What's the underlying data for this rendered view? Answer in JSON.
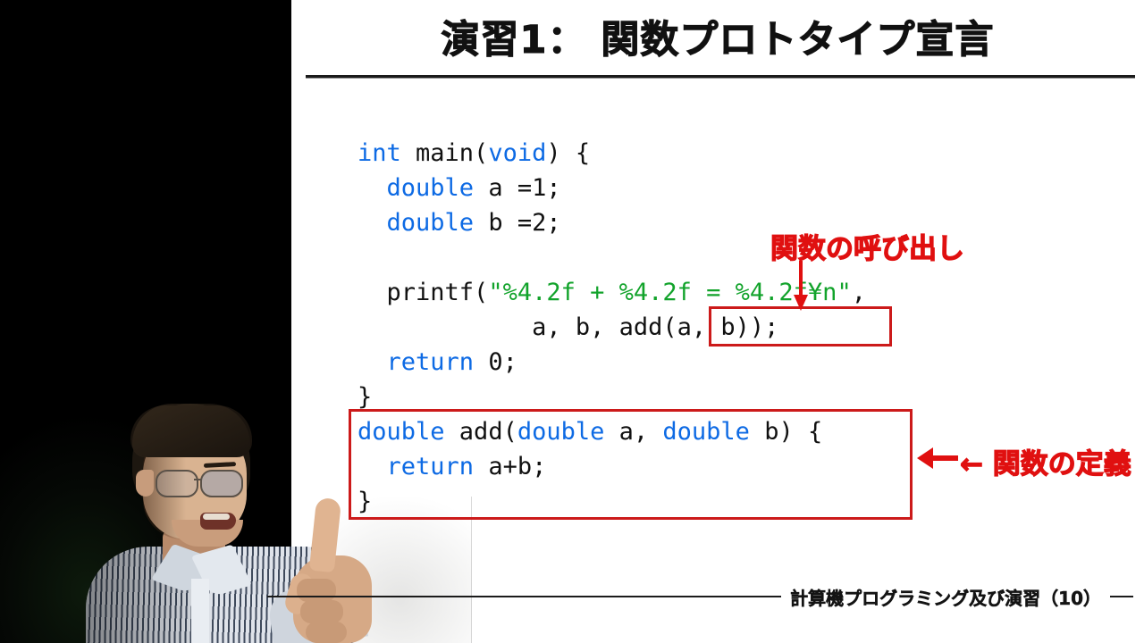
{
  "slide": {
    "title": "演習1： 関数プロトタイプ宣言",
    "footer_text": "計算機プログラミング及び演習（10）"
  },
  "code": {
    "lines": [
      [
        {
          "t": "int",
          "c": "kw"
        },
        {
          "t": " main(",
          "c": "pl"
        },
        {
          "t": "void",
          "c": "kw"
        },
        {
          "t": ") {",
          "c": "pl"
        }
      ],
      [
        {
          "t": "  ",
          "c": "pl"
        },
        {
          "t": "double",
          "c": "kw"
        },
        {
          "t": " a =1;",
          "c": "pl"
        }
      ],
      [
        {
          "t": "  ",
          "c": "pl"
        },
        {
          "t": "double",
          "c": "kw"
        },
        {
          "t": " b =2;",
          "c": "pl"
        }
      ],
      [
        {
          "t": "",
          "c": "pl"
        }
      ],
      [
        {
          "t": "  printf(",
          "c": "pl"
        },
        {
          "t": "\"%4.2f + %4.2f = %4.2f¥n\"",
          "c": "str"
        },
        {
          "t": ",",
          "c": "pl"
        }
      ],
      [
        {
          "t": "            a, b, add(a, b));",
          "c": "pl"
        }
      ],
      [
        {
          "t": "  ",
          "c": "pl"
        },
        {
          "t": "return",
          "c": "kw"
        },
        {
          "t": " 0;",
          "c": "pl"
        }
      ],
      [
        {
          "t": "}",
          "c": "pl"
        }
      ],
      [
        {
          "t": "",
          "c": "pl"
        },
        {
          "t": "double",
          "c": "kw"
        },
        {
          "t": " add(",
          "c": "pl"
        },
        {
          "t": "double",
          "c": "kw"
        },
        {
          "t": " a, ",
          "c": "pl"
        },
        {
          "t": "double",
          "c": "kw"
        },
        {
          "t": " b) {",
          "c": "pl"
        }
      ],
      [
        {
          "t": "  ",
          "c": "pl"
        },
        {
          "t": "return",
          "c": "kw"
        },
        {
          "t": " a+b;",
          "c": "pl"
        }
      ],
      [
        {
          "t": "}",
          "c": "pl"
        }
      ]
    ]
  },
  "annotations": {
    "function_call_label": "関数の呼び出し",
    "function_definition_label": "← 関数の定義"
  },
  "colors": {
    "keyword_blue": "#0d6ae4",
    "string_green": "#12a32b",
    "annotation_red": "#e01010",
    "box_red": "#cc1a1a",
    "text_black": "#111111"
  }
}
